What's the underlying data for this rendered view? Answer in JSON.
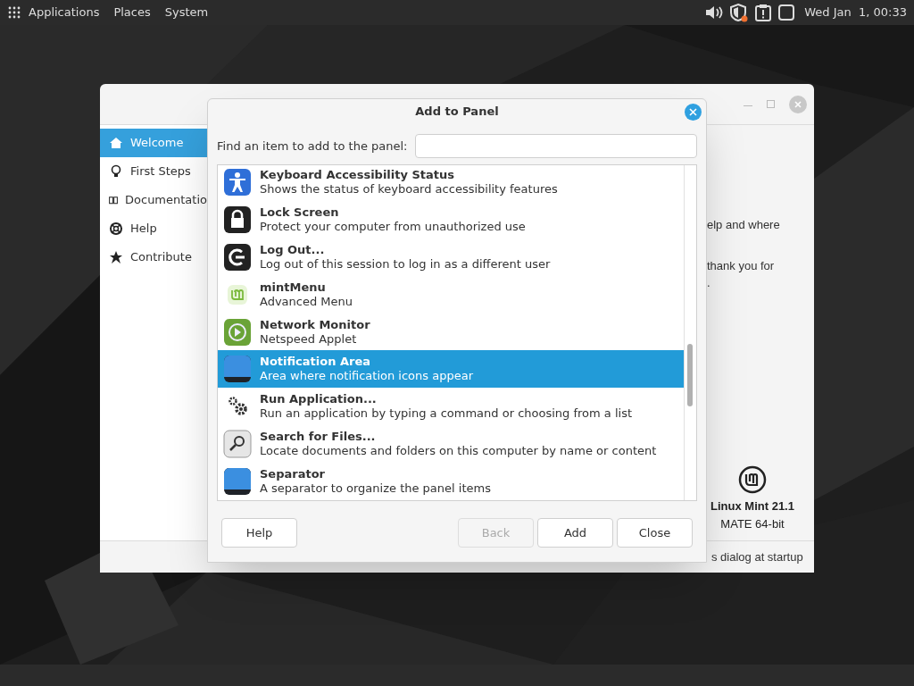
{
  "top_panel": {
    "menus": [
      "Applications",
      "Places",
      "System"
    ],
    "clock": "Wed Jan  1, 00:33"
  },
  "welcome_window": {
    "sidebar": [
      {
        "label": "Welcome",
        "selected": true
      },
      {
        "label": "First Steps",
        "selected": false
      },
      {
        "label": "Documentatio",
        "selected": false
      },
      {
        "label": "Help",
        "selected": false
      },
      {
        "label": "Contribute",
        "selected": false
      }
    ],
    "content_lines": [
      "elp and where",
      "thank you for",
      "."
    ],
    "logo_title": "Linux Mint 21.1",
    "logo_subtitle": "MATE 64-bit",
    "footer_text": "s dialog at startup"
  },
  "dialog": {
    "title": "Add to Panel",
    "search_label": "Find an item to add to the panel:",
    "items": [
      {
        "kind": "accessibility",
        "name": "Keyboard Accessibility Status",
        "description": "Shows the status of keyboard accessibility features",
        "selected": false
      },
      {
        "kind": "lock",
        "name": "Lock Screen",
        "description": "Protect your computer from unauthorized use",
        "selected": false
      },
      {
        "kind": "logout",
        "name": "Log Out...",
        "description": "Log out of this session to log in as a different user",
        "selected": false
      },
      {
        "kind": "mint",
        "name": "mintMenu",
        "description": "Advanced Menu",
        "selected": false
      },
      {
        "kind": "network",
        "name": "Network Monitor",
        "description": "Netspeed Applet",
        "selected": false
      },
      {
        "kind": "panel",
        "name": "Notification Area",
        "description": "Area where notification icons appear",
        "selected": true
      },
      {
        "kind": "gears",
        "name": "Run Application...",
        "description": "Run an application by typing a command or choosing from a list",
        "selected": false
      },
      {
        "kind": "search",
        "name": "Search for Files...",
        "description": "Locate documents and folders on this computer by name or content",
        "selected": false
      },
      {
        "kind": "panel",
        "name": "Separator",
        "description": "A separator to organize the panel items",
        "selected": false
      }
    ],
    "buttons": [
      {
        "label": "Help",
        "disabled": false
      },
      {
        "label": "Back",
        "disabled": true
      },
      {
        "label": "Add",
        "disabled": false
      },
      {
        "label": "Close",
        "disabled": false
      }
    ]
  }
}
